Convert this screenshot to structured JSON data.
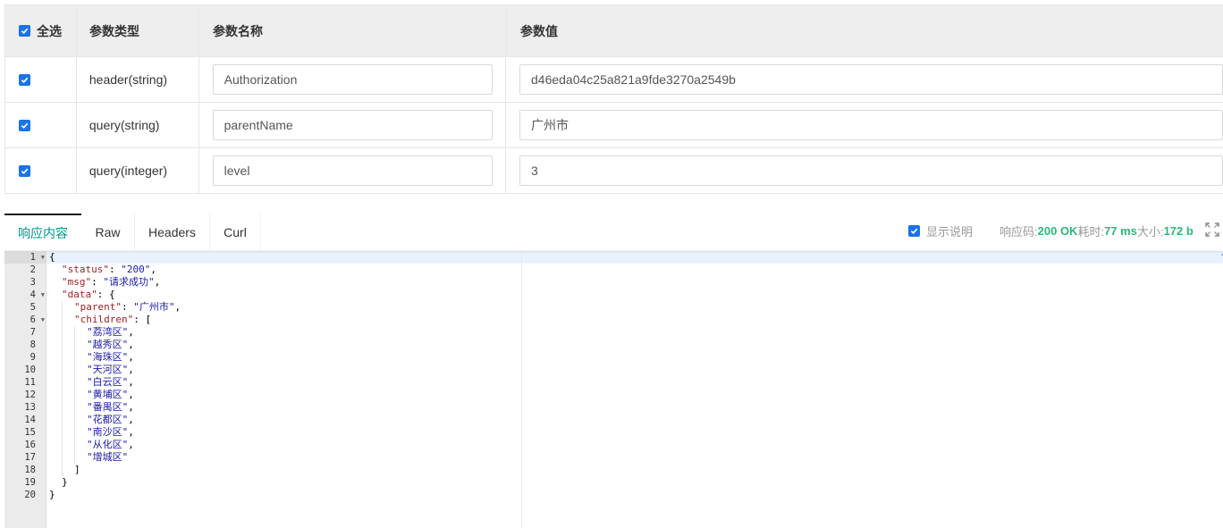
{
  "params_table": {
    "headers": {
      "select_all": "全选",
      "param_type": "参数类型",
      "param_name": "参数名称",
      "param_value": "参数值"
    },
    "rows": [
      {
        "checked": true,
        "type": "header(string)",
        "name": "Authorization",
        "value": "d46eda04c25a821a9fde3270a2549b"
      },
      {
        "checked": true,
        "type": "query(string)",
        "name": "parentName",
        "value": "广州市"
      },
      {
        "checked": true,
        "type": "query(integer)",
        "name": "level",
        "value": "3"
      }
    ]
  },
  "response": {
    "tabs": [
      "响应内容",
      "Raw",
      "Headers",
      "Curl"
    ],
    "active_tab": "响应内容",
    "show_desc_label": "显示说明",
    "status_code_label": "响应码:",
    "status_code_value": "200 OK",
    "time_label": "耗时:",
    "time_value": "77 ms",
    "size_label": "大小:",
    "size_value": "172 b"
  },
  "editor": {
    "line_numbers": [
      "1",
      "2",
      "3",
      "4",
      "5",
      "6",
      "7",
      "8",
      "9",
      "10",
      "11",
      "12",
      "13",
      "14",
      "15",
      "16",
      "17",
      "18",
      "19",
      "20"
    ],
    "status_key": "\"status\"",
    "status_val": "\"200\"",
    "msg_key": "\"msg\"",
    "msg_val": "\"请求成功\"",
    "data_key": "\"data\"",
    "parent_key": "\"parent\"",
    "parent_val": "\"广州市\"",
    "children_key": "\"children\"",
    "children": [
      "\"荔湾区\"",
      "\"越秀区\"",
      "\"海珠区\"",
      "\"天河区\"",
      "\"白云区\"",
      "\"黄埔区\"",
      "\"番禺区\"",
      "\"花都区\"",
      "\"南沙区\"",
      "\"从化区\"",
      "\"增城区\""
    ]
  },
  "colors": {
    "accent": "#009688",
    "status_green": "#2db67c",
    "checkbox_blue": "#1a73e8"
  }
}
